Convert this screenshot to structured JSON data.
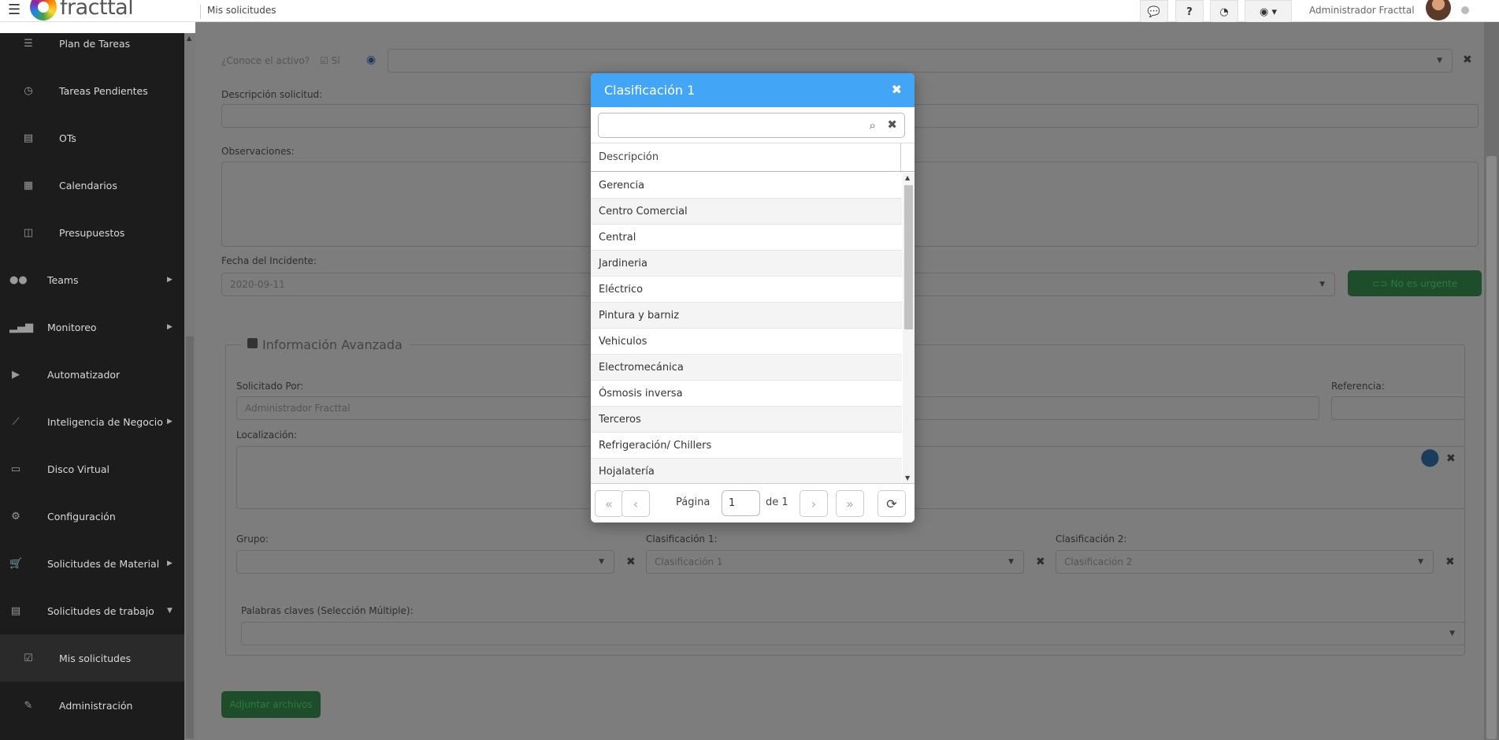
{
  "topbar": {
    "menu_icon": "hamburger-icon",
    "logo_text": "fracttal",
    "page_title": "Mis solicitudes",
    "buttons": [
      {
        "icon": "chat-icon",
        "glyph": "💬"
      },
      {
        "icon": "help-icon",
        "glyph": "?"
      },
      {
        "icon": "dashboard-icon",
        "glyph": "◔"
      },
      {
        "icon": "globe-icon",
        "glyph": "◉ ▾"
      }
    ],
    "user_name": "Administrador Fracttal"
  },
  "sidebar": {
    "items": [
      {
        "label": "Plan de Tareas",
        "icon": "list-icon",
        "glyph": "☰",
        "level": 1
      },
      {
        "label": "Tareas Pendientes",
        "icon": "clock-icon",
        "glyph": "◷",
        "level": 1
      },
      {
        "label": "OTs",
        "icon": "document-icon",
        "glyph": "▤",
        "level": 1
      },
      {
        "label": "Calendarios",
        "icon": "calendar-icon",
        "glyph": "▦",
        "level": 1
      },
      {
        "label": "Presupuestos",
        "icon": "columns-icon",
        "glyph": "◫",
        "level": 1
      },
      {
        "label": "Teams",
        "icon": "users-icon",
        "glyph": "●●",
        "level": 0,
        "arrow": "▶"
      },
      {
        "label": "Monitoreo",
        "icon": "signal-icon",
        "glyph": "▂▄▆",
        "level": 0,
        "arrow": "▶"
      },
      {
        "label": "Automatizador",
        "icon": "play-icon",
        "glyph": "▶",
        "level": 0
      },
      {
        "label": "Inteligencia de Negocio",
        "icon": "line-chart-icon",
        "glyph": "⟋",
        "level": 0,
        "arrow": "▶"
      },
      {
        "label": "Disco Virtual",
        "icon": "hdd-icon",
        "glyph": "▭",
        "level": 0
      },
      {
        "label": "Configuración",
        "icon": "gear-icon",
        "glyph": "⚙",
        "level": 0
      },
      {
        "label": "Solicitudes de Material",
        "icon": "cart-icon",
        "glyph": "🛒",
        "level": 0,
        "arrow": "▶"
      },
      {
        "label": "Solicitudes de trabajo",
        "icon": "list-alt-icon",
        "glyph": "▤",
        "level": 0,
        "arrow": "▼"
      },
      {
        "label": "Mis solicitudes",
        "icon": "check-square-icon",
        "glyph": "☑",
        "level": 1
      },
      {
        "label": "Administración",
        "icon": "edit-icon",
        "glyph": "✎",
        "level": 1
      }
    ]
  },
  "form": {
    "asset_question": "¿Conoce el activo?",
    "asset_toggle": "Sí",
    "description_label": "Descripción solicitud:",
    "observations_label": "Observaciones:",
    "incident_date_label": "Fecha del Incidente:",
    "incident_date_value": "2020-09-11",
    "urgent_toggle": "No es urgente",
    "advanced_legend": "Información Avanzada",
    "requested_by_label": "Solicitado Por:",
    "requested_by_value": "Administrador Fracttal",
    "reference_label": "Referencia:",
    "location_label": "Localización:",
    "group_label": "Grupo:",
    "class1_label": "Clasificación 1:",
    "class1_placeholder": "Clasificación 1",
    "class2_label": "Clasificación 2:",
    "class2_placeholder": "Clasificación 2",
    "keywords_label": "Palabras claves (Selección Múltiple):",
    "attach_button": "Adjuntar archivos"
  },
  "modal": {
    "title": "Clasificación 1",
    "search_value": "",
    "column_header": "Descripción",
    "rows": [
      "Gerencia",
      "Centro Comercial",
      "Central",
      "Jardineria",
      "Eléctrico",
      "Pintura y barniz",
      "Vehiculos",
      "Electromecánica",
      "Ósmosis inversa",
      "Terceros",
      "Refrigeración/ Chillers",
      "Hojalatería"
    ],
    "page_label": "Página",
    "page_value": "1",
    "of_label": "de 1"
  }
}
